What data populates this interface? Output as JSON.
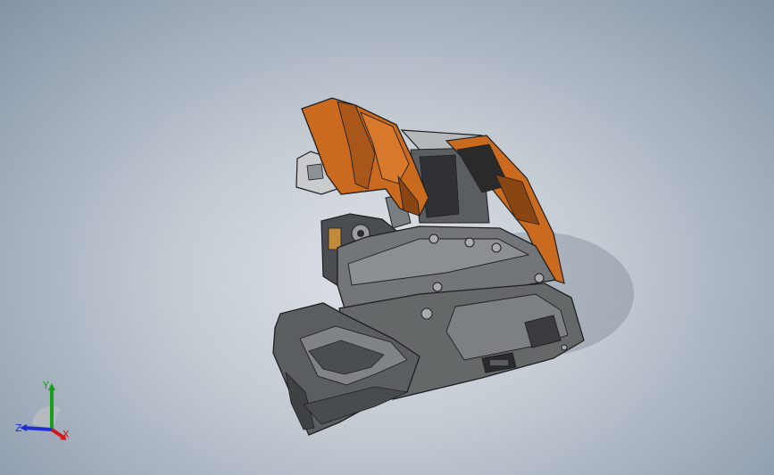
{
  "viewport": {
    "background_top": "#8593a5",
    "background_center": "#dfe3e8"
  },
  "model": {
    "body_color": "#6b6e72",
    "body_highlight": "#9a9da1",
    "cover_color": "#c96a1e",
    "cover_dark": "#8a4612",
    "edge_color": "#1e1f21"
  },
  "triad": {
    "x_label": "X",
    "y_label": "Y",
    "z_label": "Z",
    "x_color": "#d01818",
    "y_color": "#17a017",
    "z_color": "#1c2fd0"
  }
}
